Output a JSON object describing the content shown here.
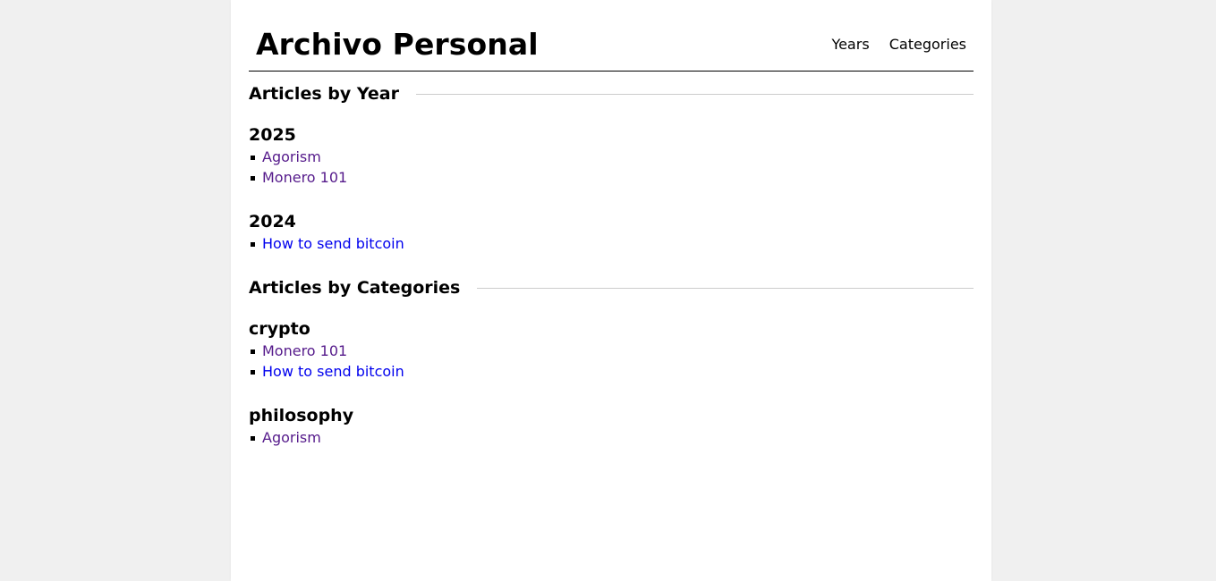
{
  "header": {
    "site_title": "Archivo Personal",
    "nav": [
      {
        "label": "Years"
      },
      {
        "label": "Categories"
      }
    ]
  },
  "years_section": {
    "heading": "Articles by Year",
    "groups": [
      {
        "title": "2025",
        "articles": [
          {
            "title": "Agorism",
            "visited": true
          },
          {
            "title": "Monero 101",
            "visited": true
          }
        ]
      },
      {
        "title": "2024",
        "articles": [
          {
            "title": "How to send bitcoin",
            "visited": false
          }
        ]
      }
    ]
  },
  "categories_section": {
    "heading": "Articles by Categories",
    "groups": [
      {
        "title": "crypto",
        "articles": [
          {
            "title": "Monero 101",
            "visited": true
          },
          {
            "title": "How to send bitcoin",
            "visited": false
          }
        ]
      },
      {
        "title": "philosophy",
        "articles": [
          {
            "title": "Agorism",
            "visited": true
          }
        ]
      }
    ]
  },
  "colors": {
    "link": "#0000ee",
    "link_visited": "#551a8b",
    "page_bg": "#f0f0f0",
    "content_bg": "#ffffff"
  }
}
